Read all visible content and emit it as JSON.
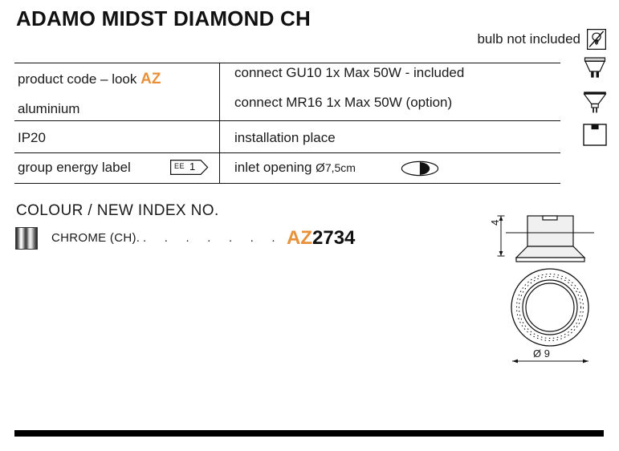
{
  "product": {
    "title": "ADAMO MIDST DIAMOND CH",
    "bulb_note": "bulb not included",
    "bulb_icon": "bulb-crossed-out-icon"
  },
  "spec_table": {
    "left_column": [
      {
        "label": "product code – look ",
        "value": "AZ",
        "value_color": "#E8913A",
        "name": "product-code"
      },
      {
        "label": "aluminium",
        "value": "",
        "name": "material"
      },
      {
        "label": "IP20",
        "value": "",
        "name": "ip-rating"
      },
      {
        "label": "group energy label",
        "badge": "EE 1",
        "badge_ee": "EE",
        "badge_num": "1",
        "name": "energy-label"
      }
    ],
    "right_column": [
      {
        "label": "connect GU10 1x Max 50W - included",
        "icon": "gu10-lamp-icon",
        "name": "connect-gu10"
      },
      {
        "label": "connect MR16 1x Max 50W (option)",
        "icon": "mr16-lamp-icon",
        "name": "connect-mr16"
      },
      {
        "label": "installation place",
        "icon": "recessed-ceiling-icon",
        "name": "installation-place"
      },
      {
        "label": "inlet opening ",
        "diameter_symbol": "Ø",
        "dimension": "7,5cm",
        "icon": "inlet-opening-icon",
        "name": "inlet-opening"
      }
    ]
  },
  "colour_section": {
    "heading": "COLOUR / NEW INDEX NO.",
    "rows": [
      {
        "swatch": "chrome-gradient-swatch",
        "name": "CHROME (CH).",
        "leader": ". . . . . . . . . . . . . .",
        "code_prefix": "AZ",
        "code_number": "2734",
        "code_prefix_color": "#E8913A"
      }
    ]
  },
  "technical_drawing": {
    "height_dimension": "4",
    "diameter_dimension": "Ø 9",
    "views": [
      "side-section-view",
      "top-view"
    ]
  },
  "colors": {
    "accent_orange": "#E8913A",
    "text_black": "#1a1a1a",
    "line_black": "#111111",
    "bar_black": "#000000"
  }
}
